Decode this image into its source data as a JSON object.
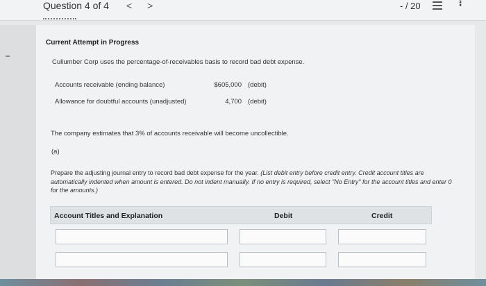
{
  "header": {
    "question_title": "Question 4 of 4",
    "prev_label": "<",
    "next_label": ">",
    "score": "- / 20",
    "more_label": "⋮"
  },
  "attempt_label": "Current Attempt in Progress",
  "intro_text": "Cullumber Corp uses the percentage-of-receivables basis to record bad debt expense.",
  "balances": [
    {
      "label": "Accounts receivable (ending balance)",
      "amount": "$605,000",
      "type": "(debit)"
    },
    {
      "label": "Allowance for doubtful accounts (unadjusted)",
      "amount": "4,700",
      "type": "(debit)"
    }
  ],
  "estimate_text": "The company estimates that 3% of accounts receivable will become uncollectible.",
  "part_label": "(a)",
  "instructions": {
    "main": "Prepare the adjusting journal entry to record bad debt expense for the year. ",
    "italic": "(List debit entry before credit entry. Credit account titles are automatically indented when amount is entered. Do not indent manually. If no entry is required, select \"No Entry\" for the account titles and enter 0 for the amounts.)"
  },
  "journal_table": {
    "columns": [
      "Account Titles and Explanation",
      "Debit",
      "Credit"
    ],
    "rows": [
      {
        "account": "",
        "debit": "",
        "credit": ""
      },
      {
        "account": "",
        "debit": "",
        "credit": ""
      }
    ]
  }
}
